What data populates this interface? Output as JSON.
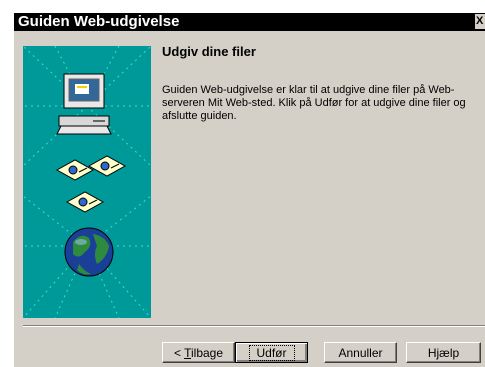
{
  "window": {
    "title": "Guiden Web-udgivelse",
    "close_glyph": "X"
  },
  "page": {
    "heading": "Udgiv dine filer",
    "description": "Guiden Web-udgivelse er klar til at udgive dine filer på Web-serveren Mit Web-sted. Klik på Udfør for at udgive dine filer og afslutte guiden."
  },
  "illustration": {
    "icons": [
      "computer-icon",
      "document-icon",
      "globe-icon"
    ],
    "background_color": "#009999"
  },
  "buttons": {
    "back_prefix": "< ",
    "back_mnemonic": "T",
    "back_rest": "ilbage",
    "finish": "Udfør",
    "cancel": "Annuller",
    "help": "Hjælp"
  }
}
